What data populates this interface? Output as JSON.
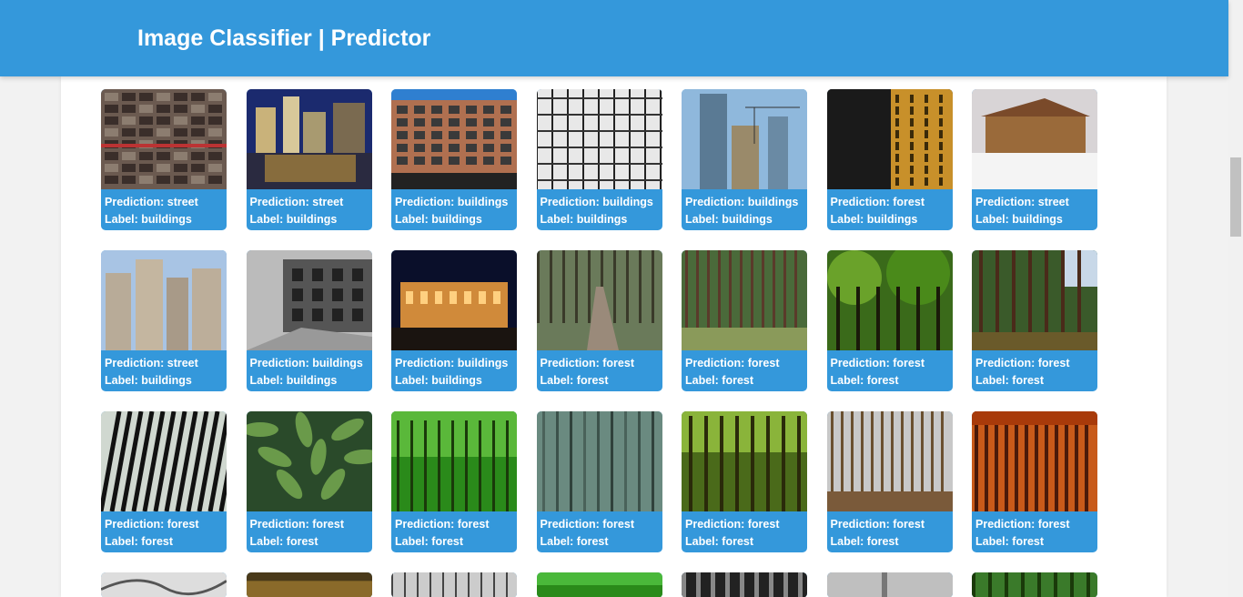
{
  "header": {
    "title": "Image Classifier | Predictor"
  },
  "labels": {
    "prediction_prefix": "Prediction: ",
    "label_prefix": "Label: "
  },
  "cards": [
    {
      "prediction": "street",
      "label": "buildings",
      "scene": "apartment-facade"
    },
    {
      "prediction": "street",
      "label": "buildings",
      "scene": "night-waterfront"
    },
    {
      "prediction": "buildings",
      "label": "buildings",
      "scene": "brick-office"
    },
    {
      "prediction": "buildings",
      "label": "buildings",
      "scene": "steel-structure-bw"
    },
    {
      "prediction": "buildings",
      "label": "buildings",
      "scene": "glass-tower-cranes"
    },
    {
      "prediction": "forest",
      "label": "buildings",
      "scene": "golden-tower"
    },
    {
      "prediction": "street",
      "label": "buildings",
      "scene": "house-in-snow"
    },
    {
      "prediction": "street",
      "label": "buildings",
      "scene": "skyscrapers"
    },
    {
      "prediction": "buildings",
      "label": "buildings",
      "scene": "old-building-bw"
    },
    {
      "prediction": "buildings",
      "label": "buildings",
      "scene": "palace-at-night"
    },
    {
      "prediction": "forest",
      "label": "forest",
      "scene": "forest-path"
    },
    {
      "prediction": "forest",
      "label": "forest",
      "scene": "pine-forest"
    },
    {
      "prediction": "forest",
      "label": "forest",
      "scene": "green-woods"
    },
    {
      "prediction": "forest",
      "label": "forest",
      "scene": "forest-trail"
    },
    {
      "prediction": "forest",
      "label": "forest",
      "scene": "dark-bamboo"
    },
    {
      "prediction": "forest",
      "label": "forest",
      "scene": "fern-closeup"
    },
    {
      "prediction": "forest",
      "label": "forest",
      "scene": "lush-green-forest"
    },
    {
      "prediction": "forest",
      "label": "forest",
      "scene": "misty-forest"
    },
    {
      "prediction": "forest",
      "label": "forest",
      "scene": "sunlit-forest"
    },
    {
      "prediction": "forest",
      "label": "forest",
      "scene": "bare-trees"
    },
    {
      "prediction": "forest",
      "label": "forest",
      "scene": "sunset-forest"
    }
  ],
  "partial_row_scenes": [
    "canopy-bw",
    "autumn-lake",
    "bare-woods-bw",
    "bright-green-forest",
    "dark-forest-bw",
    "foggy-trees",
    "green-grove"
  ],
  "colors": {
    "header": "#3498db",
    "caption_bg": "#3498db",
    "caption_text": "#ffffff",
    "page_bg": "#f2f2f2",
    "panel_bg": "#ffffff"
  }
}
